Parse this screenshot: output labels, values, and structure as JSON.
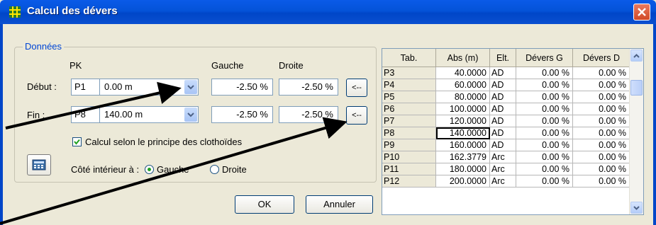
{
  "window": {
    "title": "Calcul des dévers"
  },
  "group": {
    "label": "Données"
  },
  "headers": {
    "pk": "PK",
    "gauche": "Gauche",
    "droite": "Droite"
  },
  "debut": {
    "label": "Début :",
    "point": "P1",
    "value": "0.00 m",
    "gauche": "-2.50 %",
    "droite": "-2.50 %",
    "btn": "<--"
  },
  "fin": {
    "label": "Fin :",
    "point": "P8",
    "value": "140.00 m",
    "gauche": "-2.50 %",
    "droite": "-2.50 %",
    "btn": "<--"
  },
  "clothoides": {
    "label": "Calcul selon le principe des clothoïdes",
    "checked": true
  },
  "cote": {
    "label": "Côté intérieur à :",
    "options": [
      "Gauche",
      "Droite"
    ],
    "selected": "Gauche"
  },
  "buttons": {
    "ok": "OK",
    "cancel": "Annuler"
  },
  "table": {
    "columns": [
      "Tab.",
      "Abs (m)",
      "Elt.",
      "Dévers G",
      "Dévers D"
    ],
    "rows": [
      [
        "P3",
        "40.0000",
        "AD",
        "0.00 %",
        "0.00 %"
      ],
      [
        "P4",
        "60.0000",
        "AD",
        "0.00 %",
        "0.00 %"
      ],
      [
        "P5",
        "80.0000",
        "AD",
        "0.00 %",
        "0.00 %"
      ],
      [
        "P6",
        "100.0000",
        "AD",
        "0.00 %",
        "0.00 %"
      ],
      [
        "P7",
        "120.0000",
        "AD",
        "0.00 %",
        "0.00 %"
      ],
      [
        "P8",
        "140.0000",
        "AD",
        "0.00 %",
        "0.00 %"
      ],
      [
        "P9",
        "160.0000",
        "AD",
        "0.00 %",
        "0.00 %"
      ],
      [
        "P10",
        "162.3779",
        "Arc",
        "0.00 %",
        "0.00 %"
      ],
      [
        "P11",
        "180.0000",
        "Arc",
        "0.00 %",
        "0.00 %"
      ],
      [
        "P12",
        "200.0000",
        "Arc",
        "0.00 %",
        "0.00 %"
      ]
    ],
    "selected_row": 5
  },
  "colors": {
    "titlebar": "#0453d8",
    "group_label": "#0046d5",
    "dialog_bg": "#ece9d8"
  }
}
